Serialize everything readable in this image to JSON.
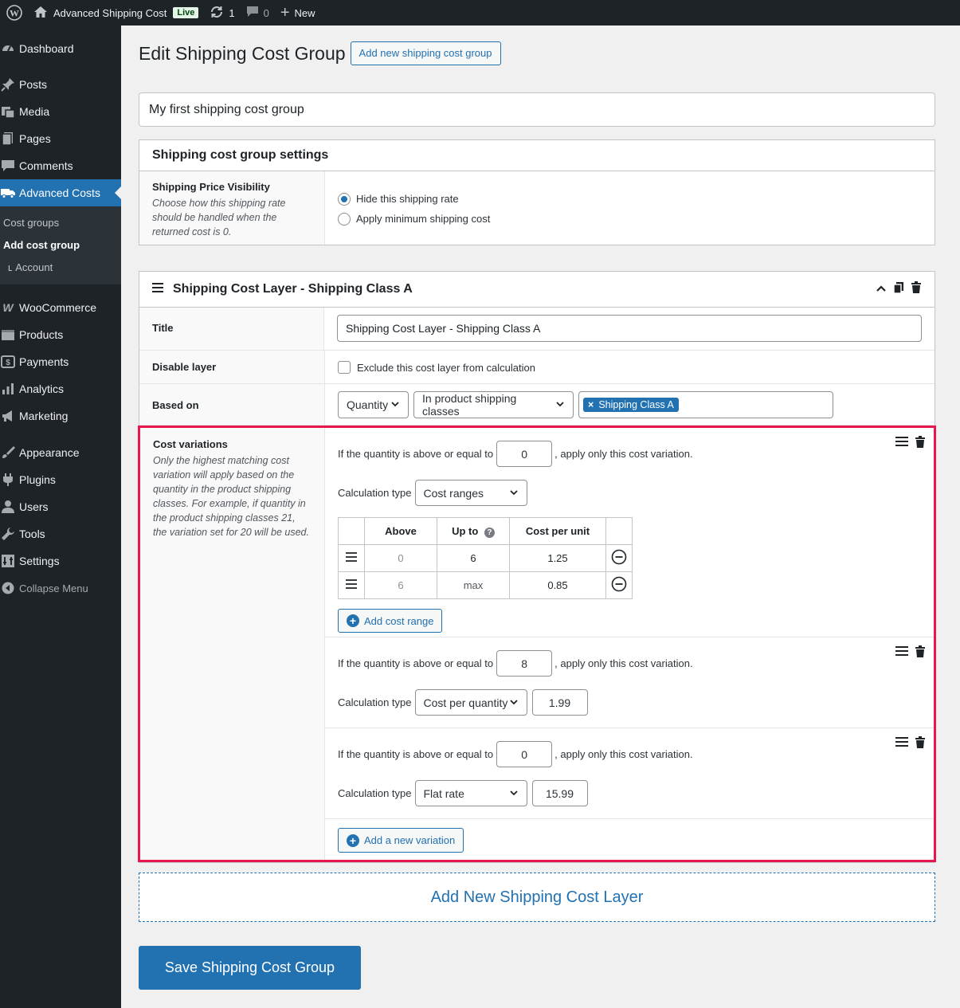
{
  "adminbar": {
    "site_name": "Advanced Shipping Cost",
    "live_badge": "Live",
    "updates_count": "1",
    "comments_count": "0",
    "new_label": "New"
  },
  "sidebar": {
    "items": [
      {
        "label": "Dashboard",
        "icon": "dashboard-icon"
      },
      {
        "label": "Posts",
        "icon": "pin-icon"
      },
      {
        "label": "Media",
        "icon": "media-icon"
      },
      {
        "label": "Pages",
        "icon": "pages-icon"
      },
      {
        "label": "Comments",
        "icon": "comment-icon"
      },
      {
        "label": "Advanced Costs",
        "icon": "truck-icon"
      },
      {
        "label": "WooCommerce",
        "icon": "woo-icon"
      },
      {
        "label": "Products",
        "icon": "products-icon"
      },
      {
        "label": "Payments",
        "icon": "payments-icon"
      },
      {
        "label": "Analytics",
        "icon": "analytics-icon"
      },
      {
        "label": "Marketing",
        "icon": "megaphone-icon"
      },
      {
        "label": "Appearance",
        "icon": "brush-icon"
      },
      {
        "label": "Plugins",
        "icon": "plug-icon"
      },
      {
        "label": "Users",
        "icon": "user-icon"
      },
      {
        "label": "Tools",
        "icon": "wrench-icon"
      },
      {
        "label": "Settings",
        "icon": "settings-icon"
      }
    ],
    "submenu": [
      "Cost groups",
      "Add cost group",
      "Account"
    ],
    "collapse_label": "Collapse Menu"
  },
  "page": {
    "title": "Edit Shipping Cost Group",
    "add_new_button": "Add new shipping cost group",
    "group_name": "My first shipping cost group"
  },
  "settings": {
    "heading": "Shipping cost group settings",
    "visibility_label": "Shipping Price Visibility",
    "visibility_desc": "Choose how this shipping rate should be handled when the returned cost is 0.",
    "option_hide": "Hide this shipping rate",
    "option_min": "Apply minimum shipping cost"
  },
  "layer": {
    "heading": "Shipping Cost Layer - Shipping Class A",
    "title_label": "Title",
    "title_value": "Shipping Cost Layer - Shipping Class A",
    "disable_label": "Disable layer",
    "disable_text": "Exclude this cost layer from calculation",
    "based_on_label": "Based on",
    "based_on_select": "Quantity",
    "condition_select": "In product shipping classes",
    "tag": "Shipping Class A",
    "tag_remove": "×"
  },
  "cost_variations": {
    "label": "Cost variations",
    "desc": "Only the highest matching cost variation will apply based on the quantity in the product shipping classes. For example, if quantity in the product shipping classes 21, the variation set for 20 will be used.",
    "prefix": "If the quantity is above or equal to",
    "suffix": ", apply only this cost variation.",
    "calc_label": "Calculation type",
    "variations": [
      {
        "threshold": "0",
        "calc_type": "Cost ranges",
        "table_headers": [
          "Above",
          "Up to",
          "Cost per unit"
        ],
        "rows": [
          {
            "above": "0",
            "up_to": "6",
            "cost": "1.25"
          },
          {
            "above": "6",
            "up_to": "max",
            "cost": "0.85"
          }
        ],
        "add_range_label": "Add cost range"
      },
      {
        "threshold": "8",
        "calc_type": "Cost per quantity",
        "value": "1.99"
      },
      {
        "threshold": "0",
        "calc_type": "Flat rate",
        "value": "15.99"
      }
    ],
    "add_variation_label": "Add a new variation"
  },
  "footer": {
    "add_layer": "Add New Shipping Cost Layer",
    "save": "Save Shipping Cost Group"
  },
  "colors": {
    "accent": "#2271b1",
    "highlight": "#e8174f",
    "sidebar": "#1d2327"
  }
}
